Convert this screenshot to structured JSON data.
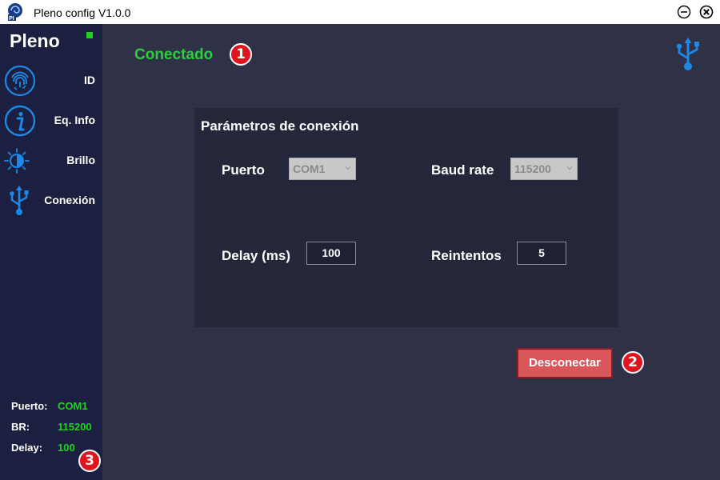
{
  "window": {
    "title": "Pleno config V1.0.0"
  },
  "sidebar": {
    "brand": "Pleno",
    "items": [
      {
        "label": "ID",
        "icon": "fingerprint-icon"
      },
      {
        "label": "Eq. Info",
        "icon": "info-icon"
      },
      {
        "label": "Brillo",
        "icon": "brightness-icon"
      },
      {
        "label": "Conexión",
        "icon": "usb-icon"
      }
    ],
    "info": {
      "puerto_label": "Puerto:",
      "puerto_value": "COM1",
      "br_label": "BR:",
      "br_value": "115200",
      "delay_label": "Delay:",
      "delay_value": "100"
    }
  },
  "main": {
    "status": "Conectado",
    "panel": {
      "title": "Parámetros de conexión",
      "puerto_label": "Puerto",
      "puerto_value": "COM1",
      "baud_label": "Baud rate",
      "baud_value": "115200",
      "delay_label": "Delay (ms)",
      "delay_value": "100",
      "retries_label": "Reintentos",
      "retries_value": "5"
    },
    "disconnect_label": "Desconectar"
  },
  "badges": {
    "one": "1",
    "two": "2",
    "three": "3"
  },
  "colors": {
    "accent_blue": "#1e88e5",
    "connected_green": "#2ecc40",
    "badge_red": "#e0141d",
    "button_red": "#d9575b"
  }
}
